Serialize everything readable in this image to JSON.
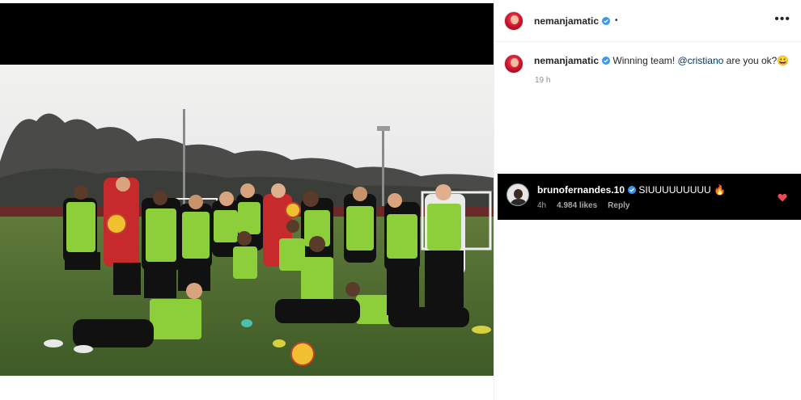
{
  "post": {
    "author": "nemanjamatic",
    "separator": "•",
    "more_icon": "more-horizontal-icon",
    "caption": {
      "author": "nemanjamatic",
      "text_before": "Winning team! ",
      "mention": "@cristiano",
      "text_after": " are you ok?😀",
      "time": "19 h"
    }
  },
  "highlighted_comment": {
    "author": "brunofernandes.10",
    "text": "SIUUUUUUUUU 🔥",
    "time": "4h",
    "likes": "4.984 likes",
    "reply_label": "Reply",
    "like_icon": "heart-icon"
  },
  "colors": {
    "verified_blue": "#3897f0",
    "heart_red": "#ed4956",
    "mention_blue": "#00376b",
    "comment_bg": "#000000"
  }
}
